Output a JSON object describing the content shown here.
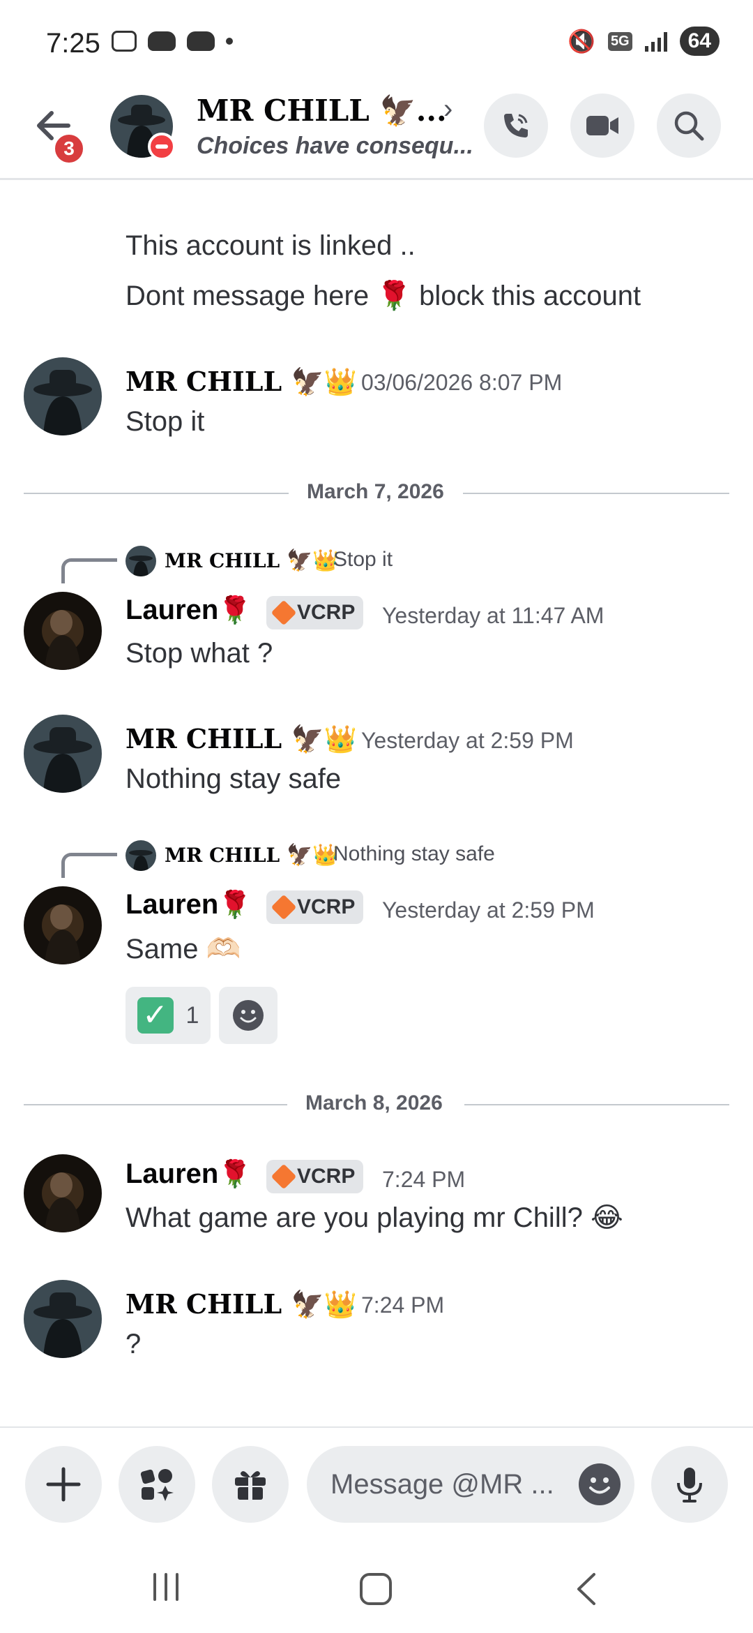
{
  "status_bar": {
    "time": "7:25",
    "network": "5G",
    "battery": "64"
  },
  "header": {
    "back_badge": "3",
    "name": "MR CHILL 🦅...",
    "subtitle": "Choices have consequ...",
    "chevron": "›"
  },
  "system_message": {
    "line1": "This account is linked ..",
    "line2": "Dont message here 🌹 block this account"
  },
  "messages": [
    {
      "author": "MR CHILL",
      "emoji": "🦅👑",
      "timestamp": "03/06/2026 8:07 PM",
      "text": "Stop it"
    },
    {
      "reply_author": "MR CHILL",
      "reply_emoji": "🦅👑",
      "reply_text": "Stop it",
      "author": "Lauren",
      "emoji": "🌹",
      "tag": "VCRP",
      "timestamp": "Yesterday at 11:47 AM",
      "text": "Stop what  ?"
    },
    {
      "author": "MR CHILL",
      "emoji": "🦅👑",
      "timestamp": "Yesterday at 2:59 PM",
      "text": "Nothing stay safe"
    },
    {
      "reply_author": "MR CHILL",
      "reply_emoji": "🦅👑",
      "reply_text": "Nothing stay safe",
      "author": "Lauren",
      "emoji": "🌹",
      "tag": "VCRP",
      "timestamp": "Yesterday at 2:59 PM",
      "text": "Same 🫶🏻",
      "reaction_count": "1"
    },
    {
      "author": "Lauren",
      "emoji": "🌹",
      "tag": "VCRP",
      "timestamp": "7:24 PM",
      "text": "What game are you playing mr Chill? 😂"
    },
    {
      "author": "MR CHILL",
      "emoji": "🦅👑",
      "timestamp": "7:24 PM",
      "text": "?"
    }
  ],
  "dividers": [
    "March 7, 2026",
    "March 8, 2026"
  ],
  "composer": {
    "placeholder": "Message @MR ..."
  },
  "icons": {
    "back": "arrow-left-icon",
    "call": "phone-icon",
    "video": "video-camera-icon",
    "search": "search-icon",
    "add": "plus-icon",
    "apps": "apps-icon",
    "gift": "gift-icon",
    "emoji": "emoji-icon",
    "mic": "microphone-icon"
  },
  "colors": {
    "badge": "#d83c3e",
    "dnd": "#f23f43",
    "tag_gem": "#f57731",
    "check": "#43b581"
  }
}
